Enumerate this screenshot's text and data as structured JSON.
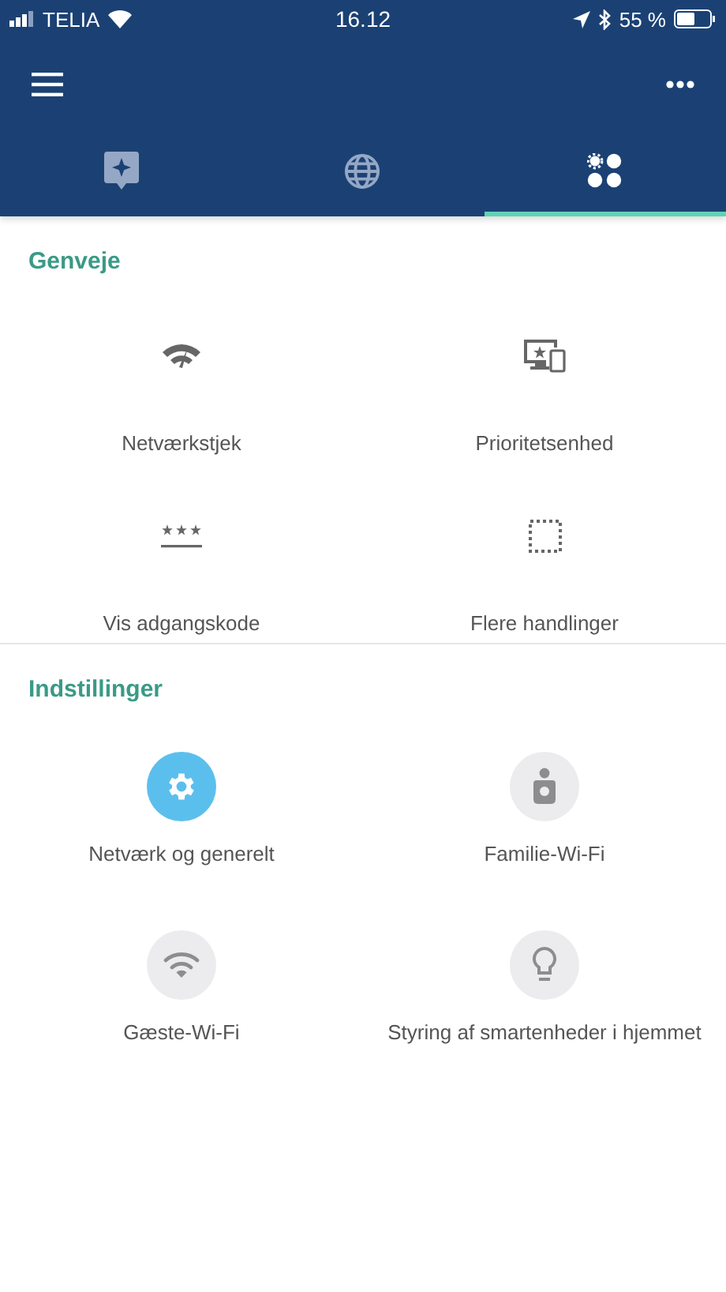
{
  "status_bar": {
    "carrier": "TELIA",
    "time": "16.12",
    "battery": "55 %"
  },
  "tabs": [
    {
      "selected": false
    },
    {
      "selected": false
    },
    {
      "selected": true
    }
  ],
  "shortcuts": {
    "title": "Genveje",
    "items": [
      {
        "label": "Netværkstjek"
      },
      {
        "label": "Prioritetsenhed"
      },
      {
        "label": "Vis adgangskode"
      },
      {
        "label": "Flere handlinger"
      }
    ]
  },
  "settings": {
    "title": "Indstillinger",
    "items": [
      {
        "label": "Netværk og generelt",
        "selected": true
      },
      {
        "label": "Familie-Wi-Fi",
        "selected": false
      },
      {
        "label": "Gæste-Wi-Fi",
        "selected": false
      },
      {
        "label": "Styring af smartenheder i hjemmet",
        "selected": false
      }
    ]
  }
}
